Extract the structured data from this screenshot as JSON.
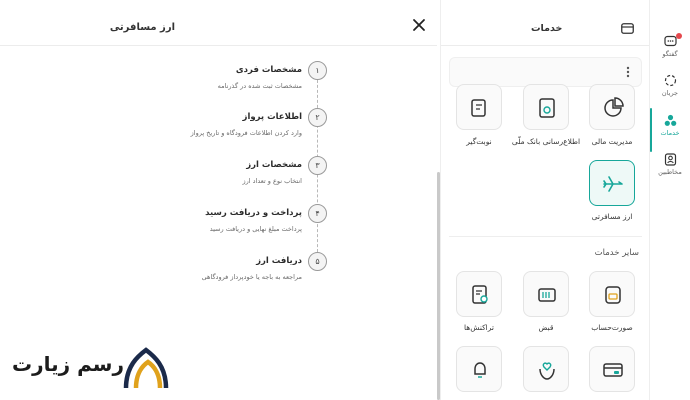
{
  "left_panel": {
    "title": "ارز مسافرتی",
    "steps": [
      {
        "num": "۱",
        "title": "مشخصات فردی",
        "desc": "مشخصات ثبت شده در گذرنامه"
      },
      {
        "num": "۲",
        "title": "اطلاعات پرواز",
        "desc": "وارد کردن اطلاعات فرودگاه و تاریخ پرواز"
      },
      {
        "num": "۳",
        "title": "مشخصات ارز",
        "desc": "انتخاب نوع و تعداد ارز"
      },
      {
        "num": "۴",
        "title": "پرداخت و دریافت رسید",
        "desc": "پرداخت مبلغ نهایی و دریافت رسید"
      },
      {
        "num": "۵",
        "title": "دریافت ارز",
        "desc": "مراجعه به باجه یا خودپرداز فرودگاهی"
      }
    ],
    "logo_text": "رسم زیارت"
  },
  "services": {
    "title": "خدمات",
    "tiles": [
      {
        "label": "مدیریت مالی",
        "icon": "pie-chart-icon"
      },
      {
        "label": "اطلاع‌رسانی بانک ملّی",
        "icon": "notification-doc-icon"
      },
      {
        "label": "نوبت‌گیر",
        "icon": "queue-ticket-icon"
      },
      {
        "label": "ارز مسافرتی",
        "icon": "airplane-icon"
      }
    ],
    "other_title": "سایر خدمات",
    "other_tiles": [
      {
        "label": "صورت‌حساب",
        "icon": "statement-icon"
      },
      {
        "label": "قبض",
        "icon": "bill-icon"
      },
      {
        "label": "تراکنش‌ها",
        "icon": "transactions-icon"
      },
      {
        "label": "",
        "icon": "card-icon"
      },
      {
        "label": "",
        "icon": "hand-support-icon"
      },
      {
        "label": "",
        "icon": "bell-icon"
      }
    ]
  },
  "rail": {
    "items": [
      {
        "label": "گفتگو",
        "icon": "chat-icon"
      },
      {
        "label": "جریان",
        "icon": "stream-icon"
      },
      {
        "label": "خدمات",
        "icon": "services-icon"
      },
      {
        "label": "مخاطبین",
        "icon": "contacts-icon"
      }
    ]
  },
  "colors": {
    "accent": "#17a79a",
    "logo_gold": "#e0a21c",
    "logo_navy": "#1b2a4a",
    "badge": "#e5484d"
  }
}
